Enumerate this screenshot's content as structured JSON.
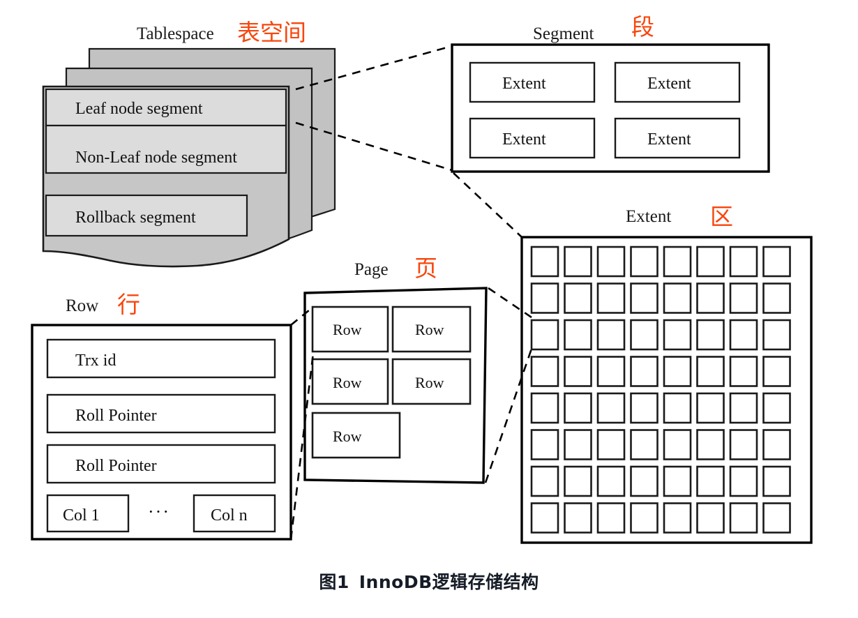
{
  "figure": {
    "caption_number": "图1",
    "caption_title": "InnoDB逻辑存储结构",
    "accent_color": "#f8460d",
    "sheet_color": "#c2c2c2",
    "segment_fill": "#dcdcdc",
    "ink_color": "#000000"
  },
  "tablespace": {
    "label_en": "Tablespace",
    "label_cn": "表空间",
    "segments": [
      "Leaf node segment",
      "Non-Leaf node segment",
      "Rollback segment"
    ],
    "sheet_count": 3
  },
  "segment": {
    "label_en": "Segment",
    "label_cn": "段",
    "extents": [
      "Extent",
      "Extent",
      "Extent",
      "Extent"
    ],
    "rows": 2,
    "cols": 2
  },
  "extent": {
    "label_en": "Extent",
    "label_cn": "区",
    "grid_rows": 8,
    "grid_cols": 8,
    "page_count": 64
  },
  "page": {
    "label_en": "Page",
    "label_cn": "页",
    "rows": [
      "Row",
      "Row",
      "Row",
      "Row",
      "Row"
    ]
  },
  "row": {
    "label_en": "Row",
    "label_cn": "行",
    "fields": [
      "Trx id",
      "Roll Pointer",
      "Roll Pointer"
    ],
    "columns": [
      "Col 1",
      "Col n"
    ],
    "ellipsis": "···"
  }
}
